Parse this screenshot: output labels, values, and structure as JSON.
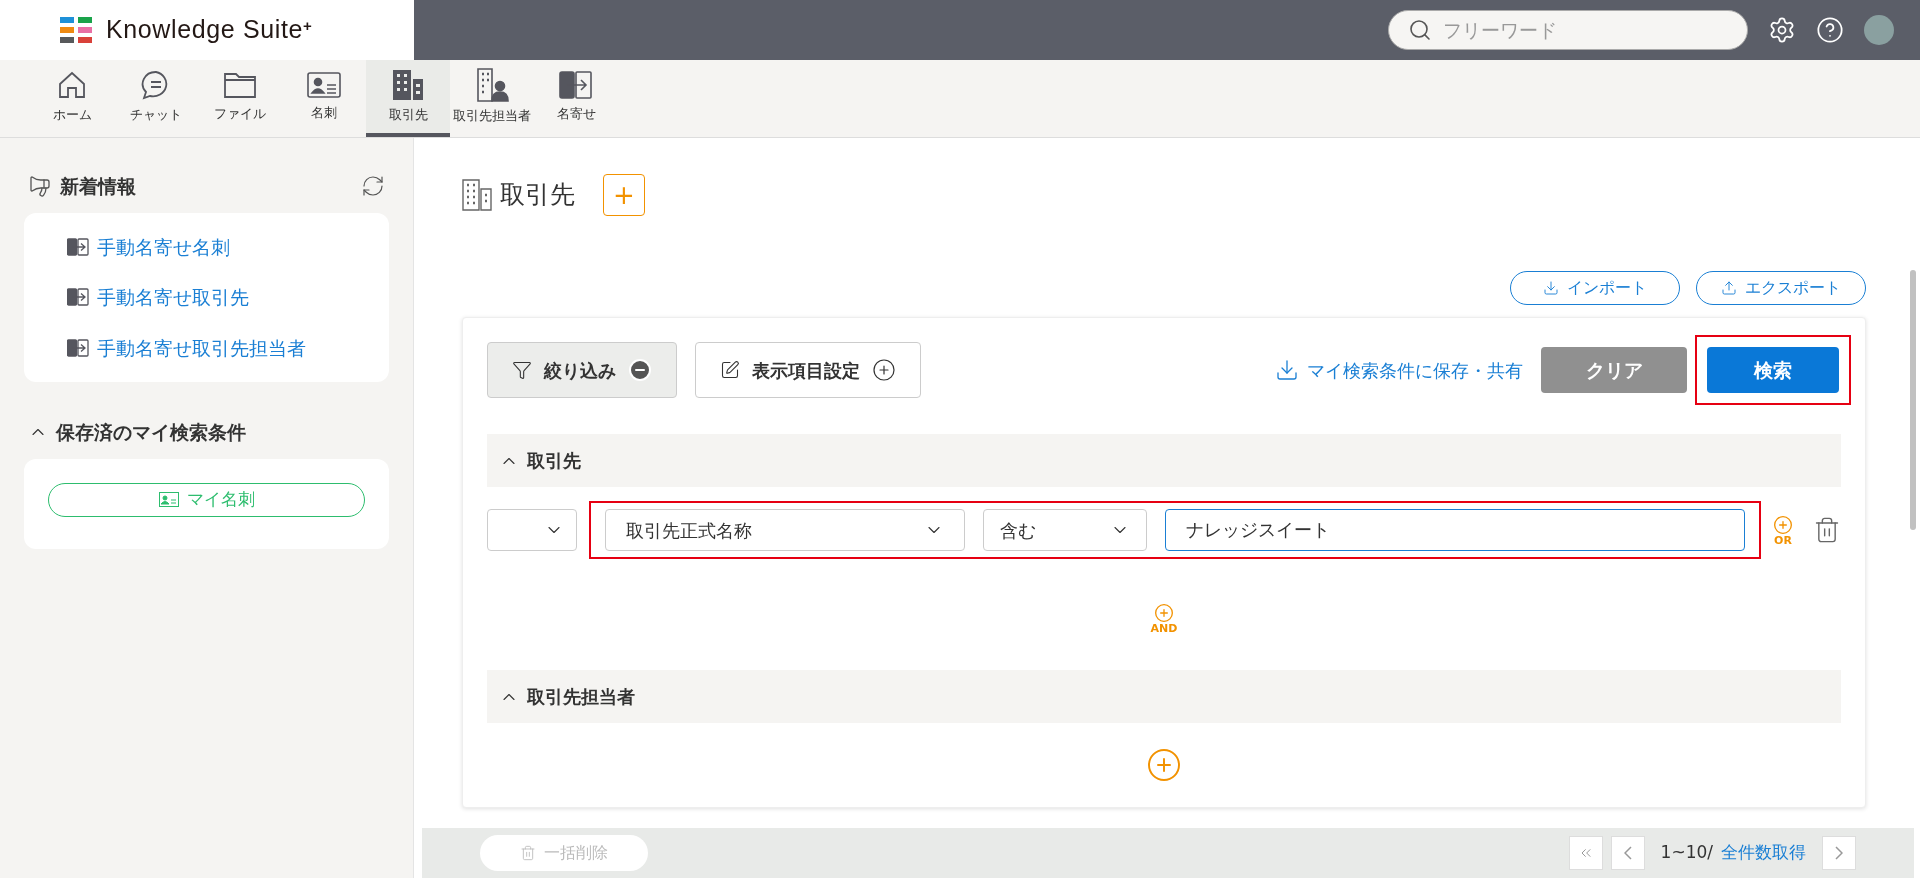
{
  "header": {
    "logo_text": "Knowledge Suite",
    "logo_sup": "+",
    "search": {
      "placeholder": "フリーワード"
    }
  },
  "nav": [
    {
      "kind": "home",
      "label": "ホーム",
      "selected": false
    },
    {
      "kind": "chat",
      "label": "チャット",
      "selected": false
    },
    {
      "kind": "file",
      "label": "ファイル",
      "selected": false
    },
    {
      "kind": "card",
      "label": "名刺",
      "selected": false
    },
    {
      "kind": "company",
      "label": "取引先",
      "selected": true
    },
    {
      "kind": "contact",
      "label": "取引先担当者",
      "selected": false
    },
    {
      "kind": "merge",
      "label": "名寄せ",
      "selected": false
    }
  ],
  "sidebar": {
    "news_title": "新着情報",
    "news_items": [
      "手動名寄せ名刺",
      "手動名寄せ取引先",
      "手動名寄せ取引先担当者"
    ],
    "saved_title": "保存済のマイ検索条件",
    "saved_expanded": true,
    "saved_items": [
      "マイ名刺"
    ]
  },
  "main": {
    "title": "取引先",
    "add": "+",
    "import": "インポート",
    "export": "エクスポート",
    "filter_toggle": {
      "label": "絞り込み",
      "expanded": true
    },
    "display_settings": "表示項目設定",
    "save_link": "マイ検索条件に保存・共有",
    "clear": "クリア",
    "search": {
      "label": "検索",
      "highlighted": true
    },
    "sections": [
      {
        "title": "取引先",
        "expanded": true,
        "conditions": [
          {
            "field": "取引先正式名称",
            "operator": "含む",
            "value": "ナレッジスイート",
            "highlighted": true,
            "or_label": "OR"
          }
        ],
        "and_label": "AND"
      },
      {
        "title": "取引先担当者",
        "expanded": true
      }
    ]
  },
  "footer": {
    "bulk_delete": {
      "label": "一括削除",
      "disabled": true
    },
    "range": "1~10/",
    "count_link": "全件数取得"
  }
}
